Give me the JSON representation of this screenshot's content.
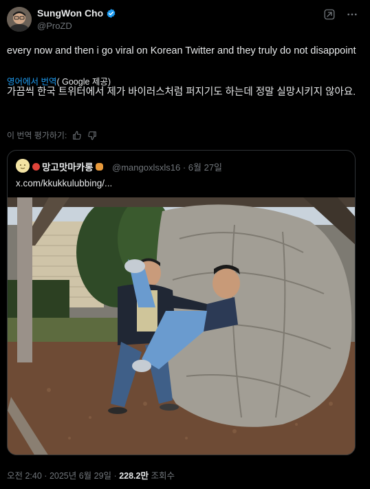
{
  "author": {
    "display_name": "SungWon Cho",
    "handle": "@ProZD",
    "verified_icon": "verified-badge-icon"
  },
  "tweet": {
    "text": "every now and then i go viral on Korean Twitter and they truly do not disappoint",
    "translated_from": "영어에서 번역",
    "translated_by": "( Google 제공)",
    "translation": "가끔씩 한국 트위터에서 제가 바이러스처럼 퍼지기도 하는데 정말 실망시키지 않아요.",
    "rate_translation": "이 번역 평가하기:"
  },
  "quote": {
    "name": "망고맛마카롱",
    "handle": "@mangoxlsxls16",
    "separator": "·",
    "date": "6월 27일",
    "link": "x.com/kkukkulubbing/..."
  },
  "footer": {
    "time": "오전 2:40",
    "separator1": "·",
    "date": "2025년 6월 29일",
    "separator2": "·",
    "views_count": "228.2만",
    "views_label": "조회수"
  },
  "colors": {
    "background": "#000000",
    "text": "#e7e9ea",
    "secondary": "#71767b",
    "accent": "#1d9bf0",
    "border": "#2f3336"
  }
}
